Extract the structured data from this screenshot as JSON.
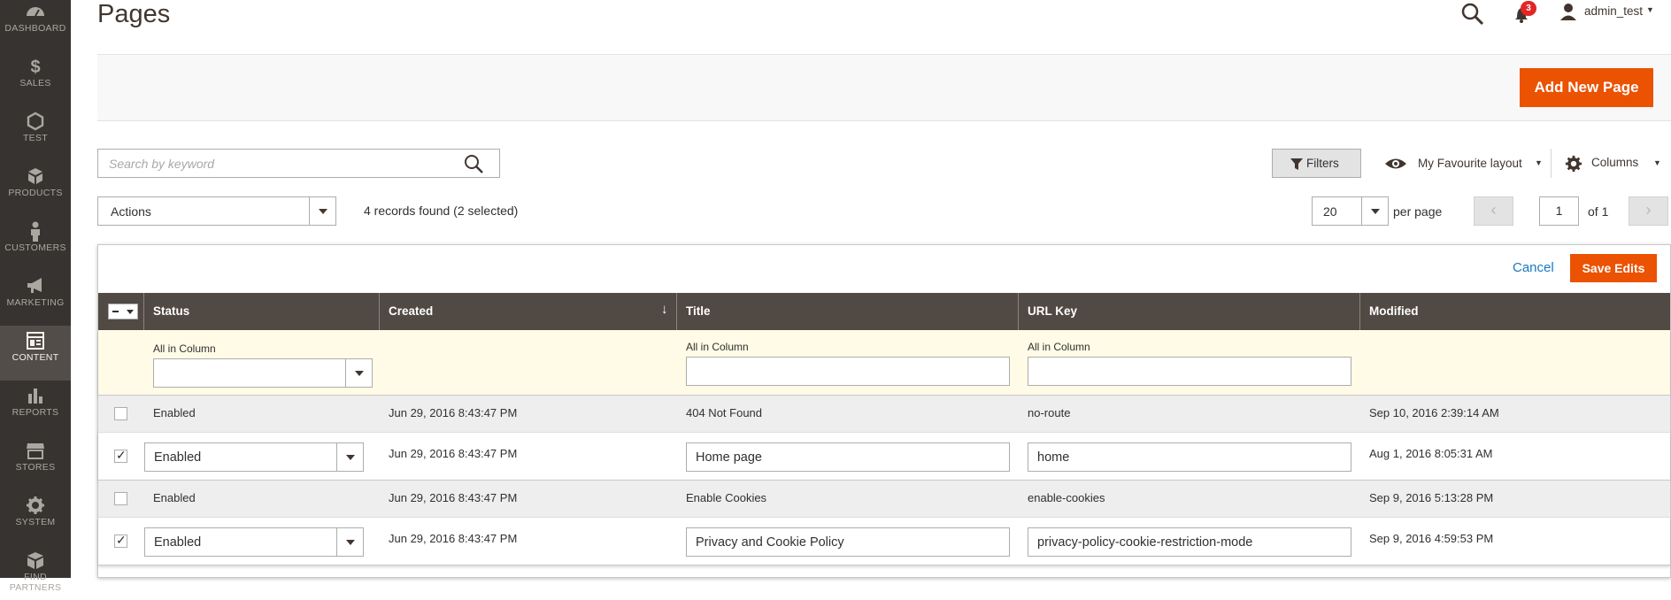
{
  "sidebar": {
    "items": [
      {
        "label": "DASHBOARD",
        "icon": "dashboard-icon",
        "active": false
      },
      {
        "label": "SALES",
        "icon": "dollar-icon",
        "active": false
      },
      {
        "label": "TEST",
        "icon": "hexagon-icon",
        "active": false
      },
      {
        "label": "PRODUCTS",
        "icon": "cube-icon",
        "active": false
      },
      {
        "label": "CUSTOMERS",
        "icon": "person-icon",
        "active": false
      },
      {
        "label": "MARKETING",
        "icon": "megaphone-icon",
        "active": false
      },
      {
        "label": "CONTENT",
        "icon": "layout-icon",
        "active": true
      },
      {
        "label": "REPORTS",
        "icon": "bar-chart-icon",
        "active": false
      },
      {
        "label": "STORES",
        "icon": "storefront-icon",
        "active": false
      },
      {
        "label": "SYSTEM",
        "icon": "gear-icon",
        "active": false
      },
      {
        "label": "FIND PARTNERS",
        "icon": "box-icon",
        "active": false
      }
    ]
  },
  "header": {
    "title": "Pages",
    "notifications_count": "3",
    "username": "admin_test"
  },
  "toolbar": {
    "add_label": "Add New Page",
    "search_placeholder": "Search by keyword",
    "filters_label": "Filters",
    "layout_label": "My Favourite layout",
    "columns_label": "Columns",
    "actions_label": "Actions",
    "records_text": "4 records found (2 selected)",
    "per_page_value": "20",
    "per_page_label": "per page",
    "page_value": "1",
    "page_of": "of 1"
  },
  "edit_bar": {
    "cancel_label": "Cancel",
    "save_label": "Save Edits"
  },
  "grid": {
    "columns": [
      "Status",
      "Created",
      "Title",
      "URL Key",
      "Modified"
    ],
    "sort_arrow": "↓",
    "filter_label": "All in Column",
    "rows": [
      {
        "checked": false,
        "editing": false,
        "status": "Enabled",
        "created": "Jun 29, 2016 8:43:47 PM",
        "title": "404 Not Found",
        "url_key": "no-route",
        "modified": "Sep 10, 2016 2:39:14 AM"
      },
      {
        "checked": true,
        "editing": true,
        "status": "Enabled",
        "created": "Jun 29, 2016 8:43:47 PM",
        "title": "Home page",
        "url_key": "home",
        "modified": "Aug 1, 2016 8:05:31 AM"
      },
      {
        "checked": false,
        "editing": false,
        "status": "Enabled",
        "created": "Jun 29, 2016 8:43:47 PM",
        "title": "Enable Cookies",
        "url_key": "enable-cookies",
        "modified": "Sep 9, 2016 5:13:28 PM"
      },
      {
        "checked": true,
        "editing": true,
        "status": "Enabled",
        "created": "Jun 29, 2016 8:43:47 PM",
        "title": "Privacy and Cookie Policy",
        "url_key": "privacy-policy-cookie-restriction-mode",
        "modified": "Sep 9, 2016 4:59:53 PM"
      }
    ]
  },
  "colors": {
    "sidebar_bg": "#373330",
    "accent": "#eb5202",
    "table_header": "#514943",
    "link": "#1979c3",
    "badge": "#e22626"
  }
}
